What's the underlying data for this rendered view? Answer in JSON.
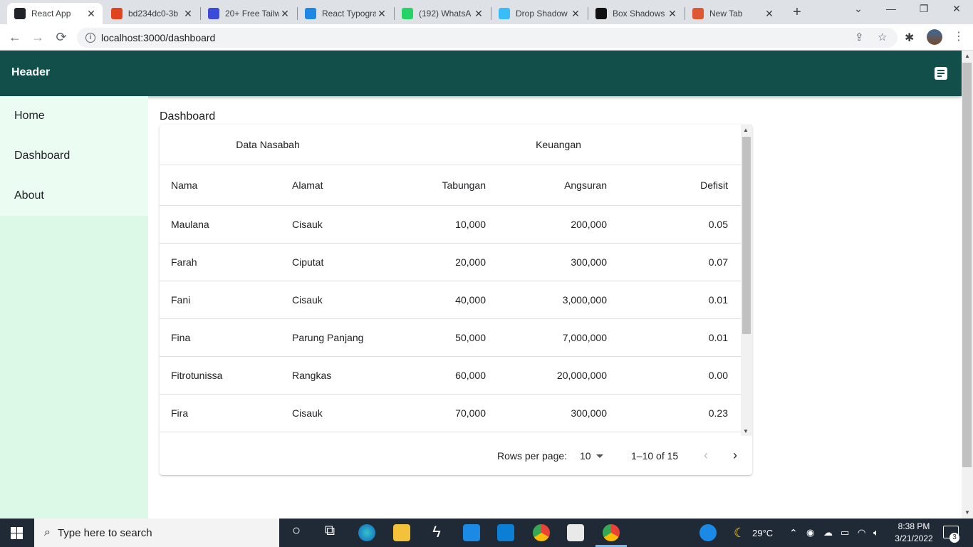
{
  "browser": {
    "tabs": [
      {
        "title": "React App",
        "icon": "react-icon",
        "color": "#20232a",
        "active": true
      },
      {
        "title": "bd234dc0-3b",
        "icon": "mailtrap-icon",
        "color": "#e0441f"
      },
      {
        "title": "20+ Free Tailw",
        "icon": "ui-icon",
        "color": "#3b4bd8"
      },
      {
        "title": "React Typogra",
        "icon": "mui-icon",
        "color": "#1e88e5"
      },
      {
        "title": "(192) WhatsA",
        "icon": "whatsapp-icon",
        "color": "#25d366"
      },
      {
        "title": "Drop Shadow",
        "icon": "tailwind-icon",
        "color": "#38bdf8"
      },
      {
        "title": "Box Shadows",
        "icon": "ma-icon",
        "color": "#111111"
      },
      {
        "title": "New Tab",
        "icon": "duckduckgo-icon",
        "color": "#de5833"
      }
    ],
    "url": "localhost:3000/dashboard"
  },
  "app": {
    "header_title": "Header",
    "sidebar": [
      {
        "label": "Home"
      },
      {
        "label": "Dashboard"
      },
      {
        "label": "About"
      }
    ],
    "page_title": "Dashboard",
    "table": {
      "group_headers": [
        "Data Nasabah",
        "Keuangan"
      ],
      "columns": [
        "Nama",
        "Alamat",
        "Tabungan",
        "Angsuran",
        "Defisit"
      ],
      "rows": [
        [
          "Maulana",
          "Cisauk",
          "10,000",
          "200,000",
          "0.05"
        ],
        [
          "Farah",
          "Ciputat",
          "20,000",
          "300,000",
          "0.07"
        ],
        [
          "Fani",
          "Cisauk",
          "40,000",
          "3,000,000",
          "0.01"
        ],
        [
          "Fina",
          "Parung Panjang",
          "50,000",
          "7,000,000",
          "0.01"
        ],
        [
          "Fitrotunissa",
          "Rangkas",
          "60,000",
          "20,000,000",
          "0.00"
        ],
        [
          "Fira",
          "Cisauk",
          "70,000",
          "300,000",
          "0.23"
        ]
      ]
    },
    "pagination": {
      "rows_per_page_label": "Rows per page:",
      "rows_per_page_value": "10",
      "range_label": "1–10 of 15"
    }
  },
  "taskbar": {
    "search_placeholder": "Type here to search",
    "weather": "29°C",
    "time": "8:38 PM",
    "date": "3/21/2022",
    "notification_count": "3"
  }
}
